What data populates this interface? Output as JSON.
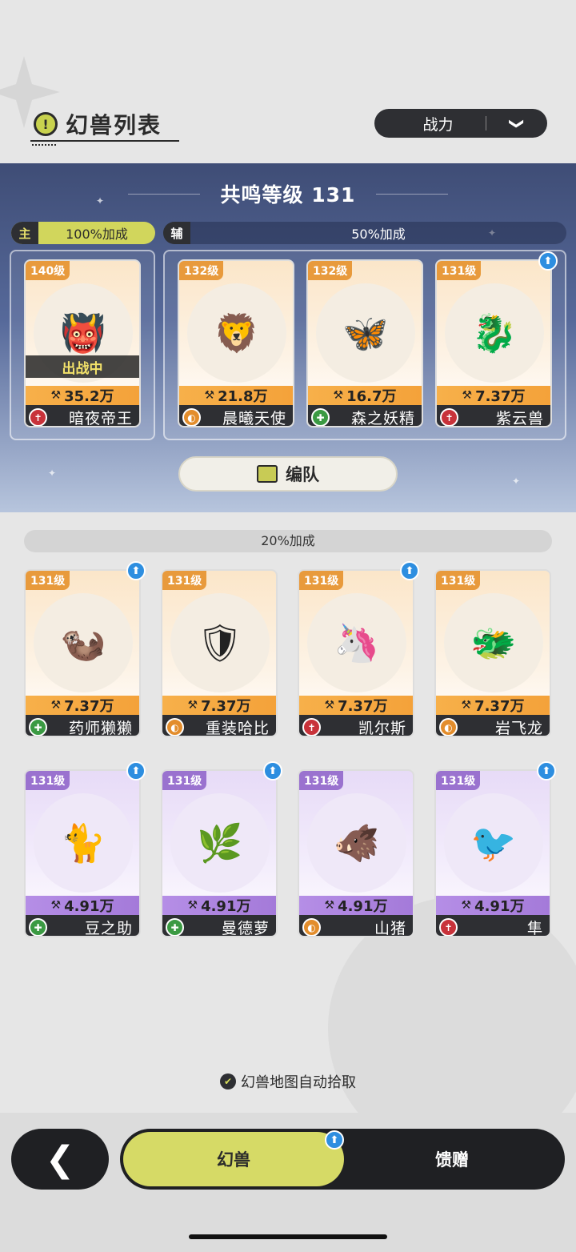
{
  "header": {
    "title": "幻兽列表",
    "sort_label": "战力",
    "sort_arrow": "❯"
  },
  "banner": {
    "resonance": "共鸣等级 131",
    "main_tag": "主",
    "main_bonus": "100%加成",
    "aux_tag": "辅",
    "aux_bonus": "50%加成",
    "formation_label": "编队",
    "main_card": {
      "level": "140级",
      "power": "35.2万",
      "name": "暗夜帝王",
      "role": "atk",
      "status": "出战中",
      "emoji": "👹"
    },
    "aux_cards": [
      {
        "level": "132级",
        "power": "21.8万",
        "name": "晨曦天使",
        "role": "def",
        "emoji": "🦁"
      },
      {
        "level": "132级",
        "power": "16.7万",
        "name": "森之妖精",
        "role": "heal",
        "emoji": "🦋"
      },
      {
        "level": "131级",
        "power": "7.37万",
        "name": "紫云兽",
        "role": "atk",
        "emoji": "🐉",
        "upgrade": true
      }
    ]
  },
  "reserve": {
    "bonus": "20%加成",
    "cards": [
      {
        "level": "131级",
        "power": "7.37万",
        "name": "药师獭獭",
        "role": "heal",
        "emoji": "🦦",
        "color": "orange",
        "upgrade": true
      },
      {
        "level": "131级",
        "power": "7.37万",
        "name": "重装哈比",
        "role": "def",
        "emoji": "🛡",
        "color": "orange",
        "upgrade": false
      },
      {
        "level": "131级",
        "power": "7.37万",
        "name": "凯尔斯",
        "role": "atk",
        "emoji": "🦄",
        "color": "orange",
        "upgrade": true
      },
      {
        "level": "131级",
        "power": "7.37万",
        "name": "岩飞龙",
        "role": "def",
        "emoji": "🐲",
        "color": "orange",
        "upgrade": false
      },
      {
        "level": "131级",
        "power": "4.91万",
        "name": "豆之助",
        "role": "heal",
        "emoji": "🐈",
        "color": "purple",
        "upgrade": true
      },
      {
        "level": "131级",
        "power": "4.91万",
        "name": "曼德萝",
        "role": "heal",
        "emoji": "🌿",
        "color": "purple",
        "upgrade": true
      },
      {
        "level": "131级",
        "power": "4.91万",
        "name": "山猪",
        "role": "def",
        "emoji": "🐗",
        "color": "purple",
        "upgrade": false
      },
      {
        "level": "131级",
        "power": "4.91万",
        "name": "隼",
        "role": "atk",
        "emoji": "🐦",
        "color": "purple",
        "upgrade": true
      }
    ]
  },
  "auto_pick": "幻兽地图自动拾取",
  "nav": {
    "back": "❮",
    "tab_active": "幻兽",
    "tab_other": "馈赠"
  },
  "icons": {
    "power": "⚒",
    "upgrade": "⬆",
    "atk": "✝",
    "def": "◐",
    "heal": "✚",
    "check": "✔",
    "alert": "!"
  },
  "colors": {
    "accent": "#d6da66",
    "dark": "#1f2023",
    "upgrade": "#2d8ee0",
    "atk": "#c8323a",
    "def": "#e38d2c",
    "heal": "#3b9a43"
  }
}
